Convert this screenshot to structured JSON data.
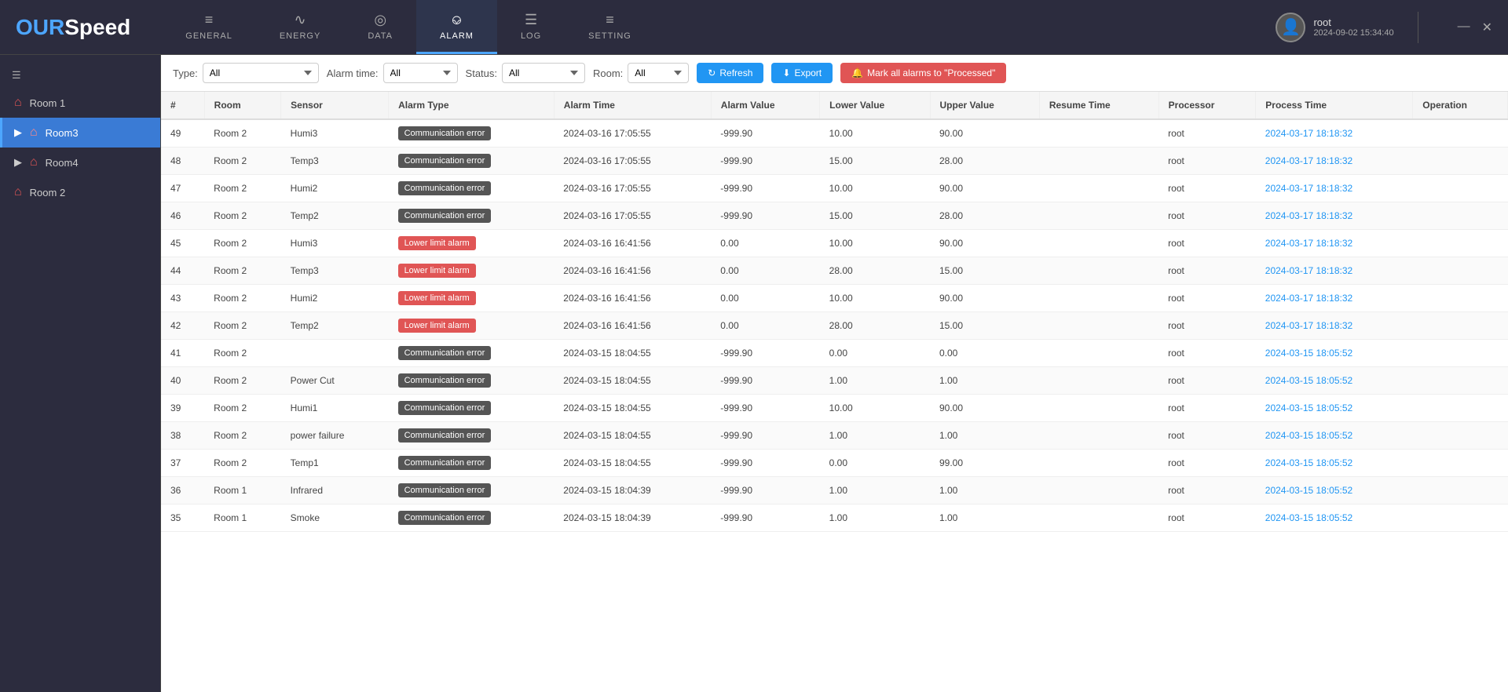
{
  "app": {
    "logo": {
      "our": "OUR",
      "speed": "Speed"
    },
    "user": {
      "name": "root",
      "datetime": "2024-09-02 15:34:40"
    },
    "window_controls": {
      "minimize": "—",
      "close": "✕"
    }
  },
  "nav": {
    "tabs": [
      {
        "id": "general",
        "icon": "≡",
        "label": "GENERAL",
        "active": false
      },
      {
        "id": "energy",
        "icon": "∿",
        "label": "ENERGY",
        "active": false
      },
      {
        "id": "data",
        "icon": "◎",
        "label": "DATA",
        "active": false
      },
      {
        "id": "alarm",
        "icon": "⊙",
        "label": "ALARM",
        "active": true
      },
      {
        "id": "log",
        "icon": "☰",
        "label": "LOG",
        "active": false
      },
      {
        "id": "setting",
        "icon": "⚙",
        "label": "SETTING",
        "active": false
      }
    ]
  },
  "sidebar": {
    "items": [
      {
        "id": "room1",
        "label": "Room 1",
        "active": false,
        "expandable": false
      },
      {
        "id": "room3",
        "label": "Room3",
        "active": true,
        "expandable": true
      },
      {
        "id": "room4",
        "label": "Room4",
        "active": false,
        "expandable": true
      },
      {
        "id": "room2",
        "label": "Room 2",
        "active": false,
        "expandable": false
      }
    ]
  },
  "toolbar": {
    "type_label": "Type:",
    "type_value": "All",
    "alarm_time_label": "Alarm time:",
    "alarm_time_value": "All",
    "status_label": "Status:",
    "status_value": "All",
    "room_label": "Room:",
    "room_value": "All",
    "refresh_label": "Refresh",
    "export_label": "Export",
    "mark_label": "Mark all alarms to \"Processed\""
  },
  "table": {
    "headers": [
      "#",
      "Room",
      "Sensor",
      "Alarm Type",
      "Alarm Time",
      "Alarm Value",
      "Lower Value",
      "Upper Value",
      "Resume Time",
      "Processor",
      "Process Time",
      "Operation"
    ],
    "rows": [
      {
        "num": 49,
        "room": "Room 2",
        "sensor": "Humi3",
        "alarm_type": "Communication error",
        "alarm_type_class": "comm",
        "alarm_time": "2024-03-16 17:05:55",
        "alarm_value": "-999.90",
        "lower_value": "10.00",
        "upper_value": "90.00",
        "resume_time": "",
        "processor": "root",
        "process_time": "2024-03-17 18:18:32",
        "operation": ""
      },
      {
        "num": 48,
        "room": "Room 2",
        "sensor": "Temp3",
        "alarm_type": "Communication error",
        "alarm_type_class": "comm",
        "alarm_time": "2024-03-16 17:05:55",
        "alarm_value": "-999.90",
        "lower_value": "15.00",
        "upper_value": "28.00",
        "resume_time": "",
        "processor": "root",
        "process_time": "2024-03-17 18:18:32",
        "operation": ""
      },
      {
        "num": 47,
        "room": "Room 2",
        "sensor": "Humi2",
        "alarm_type": "Communication error",
        "alarm_type_class": "comm",
        "alarm_time": "2024-03-16 17:05:55",
        "alarm_value": "-999.90",
        "lower_value": "10.00",
        "upper_value": "90.00",
        "resume_time": "",
        "processor": "root",
        "process_time": "2024-03-17 18:18:32",
        "operation": ""
      },
      {
        "num": 46,
        "room": "Room 2",
        "sensor": "Temp2",
        "alarm_type": "Communication error",
        "alarm_type_class": "comm",
        "alarm_time": "2024-03-16 17:05:55",
        "alarm_value": "-999.90",
        "lower_value": "15.00",
        "upper_value": "28.00",
        "resume_time": "",
        "processor": "root",
        "process_time": "2024-03-17 18:18:32",
        "operation": ""
      },
      {
        "num": 45,
        "room": "Room 2",
        "sensor": "Humi3",
        "alarm_type": "Lower limit alarm",
        "alarm_type_class": "lower",
        "alarm_time": "2024-03-16 16:41:56",
        "alarm_value": "0.00",
        "lower_value": "10.00",
        "upper_value": "90.00",
        "resume_time": "",
        "processor": "root",
        "process_time": "2024-03-17 18:18:32",
        "operation": ""
      },
      {
        "num": 44,
        "room": "Room 2",
        "sensor": "Temp3",
        "alarm_type": "Lower limit alarm",
        "alarm_type_class": "lower",
        "alarm_time": "2024-03-16 16:41:56",
        "alarm_value": "0.00",
        "lower_value": "28.00",
        "upper_value": "15.00",
        "resume_time": "",
        "processor": "root",
        "process_time": "2024-03-17 18:18:32",
        "operation": ""
      },
      {
        "num": 43,
        "room": "Room 2",
        "sensor": "Humi2",
        "alarm_type": "Lower limit alarm",
        "alarm_type_class": "lower",
        "alarm_time": "2024-03-16 16:41:56",
        "alarm_value": "0.00",
        "lower_value": "10.00",
        "upper_value": "90.00",
        "resume_time": "",
        "processor": "root",
        "process_time": "2024-03-17 18:18:32",
        "operation": ""
      },
      {
        "num": 42,
        "room": "Room 2",
        "sensor": "Temp2",
        "alarm_type": "Lower limit alarm",
        "alarm_type_class": "lower",
        "alarm_time": "2024-03-16 16:41:56",
        "alarm_value": "0.00",
        "lower_value": "28.00",
        "upper_value": "15.00",
        "resume_time": "",
        "processor": "root",
        "process_time": "2024-03-17 18:18:32",
        "operation": ""
      },
      {
        "num": 41,
        "room": "Room 2",
        "sensor": "",
        "alarm_type": "Communication error",
        "alarm_type_class": "comm",
        "alarm_time": "2024-03-15 18:04:55",
        "alarm_value": "-999.90",
        "lower_value": "0.00",
        "upper_value": "0.00",
        "resume_time": "",
        "processor": "root",
        "process_time": "2024-03-15 18:05:52",
        "operation": ""
      },
      {
        "num": 40,
        "room": "Room 2",
        "sensor": "Power Cut",
        "alarm_type": "Communication error",
        "alarm_type_class": "comm",
        "alarm_time": "2024-03-15 18:04:55",
        "alarm_value": "-999.90",
        "lower_value": "1.00",
        "upper_value": "1.00",
        "resume_time": "",
        "processor": "root",
        "process_time": "2024-03-15 18:05:52",
        "operation": ""
      },
      {
        "num": 39,
        "room": "Room 2",
        "sensor": "Humi1",
        "alarm_type": "Communication error",
        "alarm_type_class": "comm",
        "alarm_time": "2024-03-15 18:04:55",
        "alarm_value": "-999.90",
        "lower_value": "10.00",
        "upper_value": "90.00",
        "resume_time": "",
        "processor": "root",
        "process_time": "2024-03-15 18:05:52",
        "operation": ""
      },
      {
        "num": 38,
        "room": "Room 2",
        "sensor": "power failure",
        "alarm_type": "Communication error",
        "alarm_type_class": "comm",
        "alarm_time": "2024-03-15 18:04:55",
        "alarm_value": "-999.90",
        "lower_value": "1.00",
        "upper_value": "1.00",
        "resume_time": "",
        "processor": "root",
        "process_time": "2024-03-15 18:05:52",
        "operation": ""
      },
      {
        "num": 37,
        "room": "Room 2",
        "sensor": "Temp1",
        "alarm_type": "Communication error",
        "alarm_type_class": "comm",
        "alarm_time": "2024-03-15 18:04:55",
        "alarm_value": "-999.90",
        "lower_value": "0.00",
        "upper_value": "99.00",
        "resume_time": "",
        "processor": "root",
        "process_time": "2024-03-15 18:05:52",
        "operation": ""
      },
      {
        "num": 36,
        "room": "Room 1",
        "sensor": "Infrared",
        "alarm_type": "Communication error",
        "alarm_type_class": "comm",
        "alarm_time": "2024-03-15 18:04:39",
        "alarm_value": "-999.90",
        "lower_value": "1.00",
        "upper_value": "1.00",
        "resume_time": "",
        "processor": "root",
        "process_time": "2024-03-15 18:05:52",
        "operation": ""
      },
      {
        "num": 35,
        "room": "Room 1",
        "sensor": "Smoke",
        "alarm_type": "Communication error",
        "alarm_type_class": "comm",
        "alarm_time": "2024-03-15 18:04:39",
        "alarm_value": "-999.90",
        "lower_value": "1.00",
        "upper_value": "1.00",
        "resume_time": "",
        "processor": "root",
        "process_time": "2024-03-15 18:05:52",
        "operation": ""
      }
    ]
  }
}
